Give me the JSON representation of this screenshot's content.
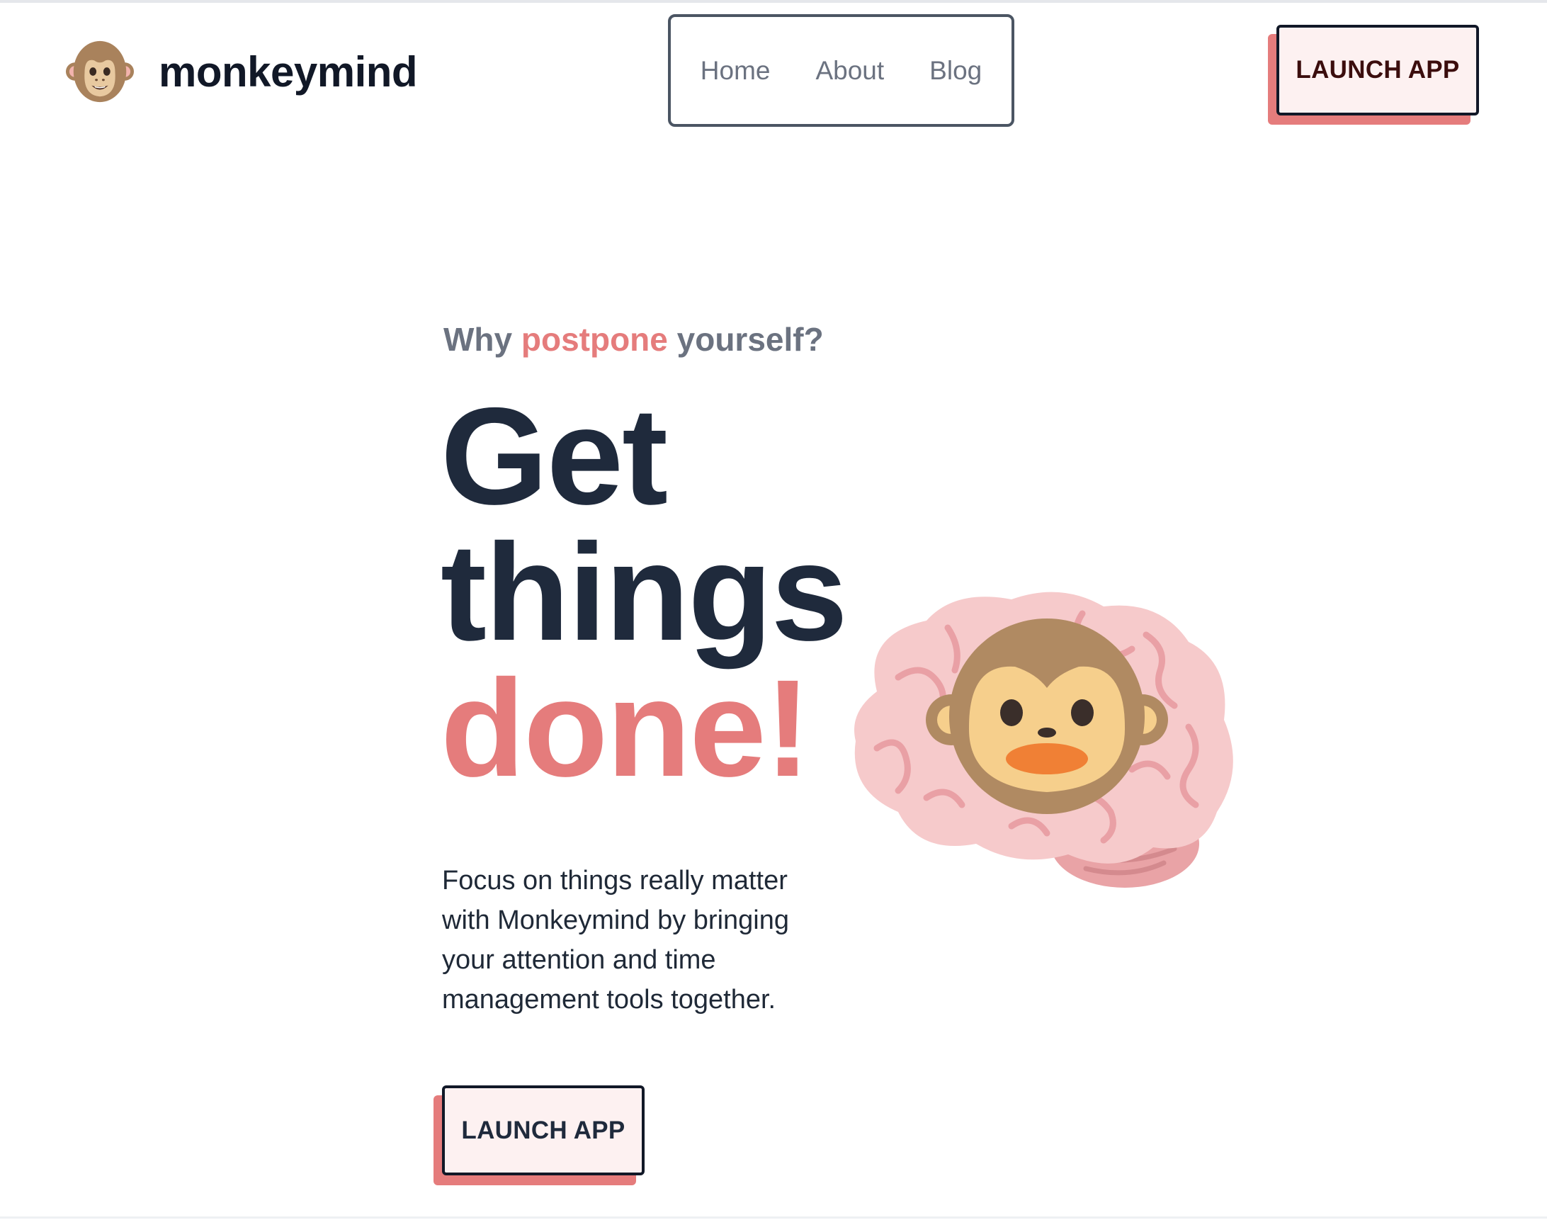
{
  "header": {
    "brand_name": "monkeymind",
    "logo_icon": "monkey-face-icon",
    "nav": [
      {
        "label": "Home"
      },
      {
        "label": "About"
      },
      {
        "label": "Blog"
      }
    ],
    "launch_label": "LAUNCH APP"
  },
  "hero": {
    "eyebrow_before": "Why",
    "eyebrow_accent": "postpone",
    "eyebrow_after": "yourself?",
    "headline_line1": "Get",
    "headline_line2": "things",
    "headline_line3": "done!",
    "description": "Focus on things really matter with Monkeymind by bringing your attention and time management tools together.",
    "cta_label": "LAUNCH APP",
    "illustration_icon": "monkey-brain-icon"
  },
  "colors": {
    "accent": "#e57c7c",
    "heading": "#1f2a3c",
    "button_bg": "#fdf1f1",
    "nav_text": "#6b7280"
  }
}
